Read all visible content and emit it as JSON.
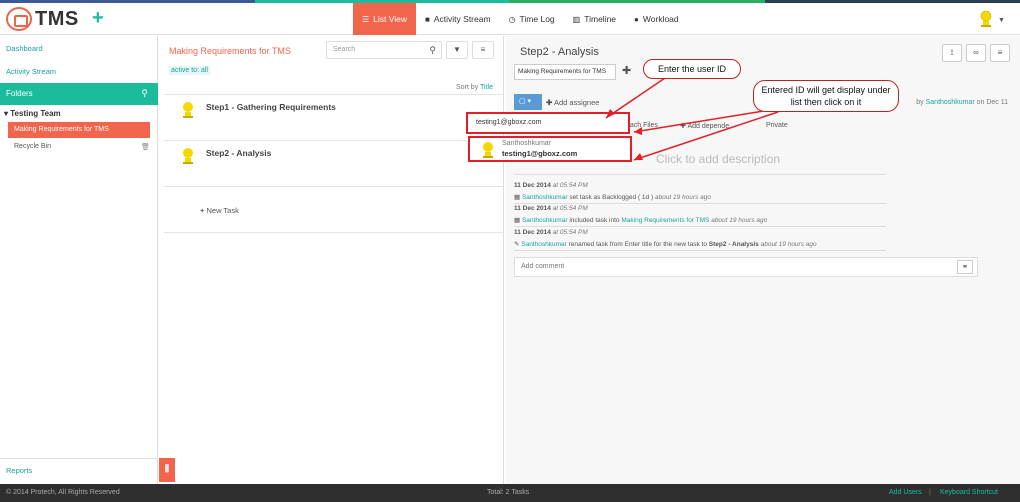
{
  "app": {
    "name": "TMS",
    "add_label": "+"
  },
  "header": {
    "tabs": [
      {
        "label": "List View",
        "icon": "list-icon",
        "active": true
      },
      {
        "label": "Activity Stream",
        "icon": "comment-icon"
      },
      {
        "label": "Time Log",
        "icon": "clock-icon"
      },
      {
        "label": "Timeline",
        "icon": "bars-icon"
      },
      {
        "label": "Workload",
        "icon": "user-icon"
      }
    ]
  },
  "sidebar": {
    "dashboard": "Dashboard",
    "activity_stream": "Activity Stream",
    "folders": "Folders",
    "team": "Testing Team",
    "active_folder": "Making Requirements for TMS",
    "recycle_bin": "Recycle Bin",
    "reports": "Reports"
  },
  "middle": {
    "title": "Making Requirements for TMS",
    "search_placeholder": "Search",
    "filter_tags": "active  to: all",
    "sort_by": "Sort by",
    "sort_field": "Title",
    "tasks": [
      "Step1 - Gathering Requirements",
      "Step2 - Analysis"
    ],
    "new_task": "New Task"
  },
  "detail": {
    "title": "Step2 - Analysis",
    "project": "Making Requirements for TMS",
    "add_assignee": "Add assignee",
    "by": "by",
    "author": "Santhoshkumar",
    "on": "on Dec 11",
    "toolbar": [
      "ttach Files",
      "Add depende",
      "Private"
    ],
    "ghost_text": "Click to add description",
    "activities": [
      {
        "date": "11 Dec 2014",
        "time": "at 05:54 PM",
        "user": "Santhoshkumar",
        "pre": "set task as Backlogged ( 1d )",
        "link": "",
        "post": "",
        "ago": "about 19 hours ago"
      },
      {
        "date": "11 Dec 2014",
        "time": "at 05:54 PM",
        "user": "Santhoshkumar",
        "pre": "included task into",
        "link": "Making Requirements for TMS",
        "post": "",
        "ago": "about 19 hours ago"
      },
      {
        "date": "11 Dec 2014",
        "time": "at 05:54 PM",
        "user": "Santhoshkumar",
        "pre": "renamed task from Enter title for the new task to",
        "link": "",
        "post": "Step2 - Analysis",
        "ago": "about 19 hours ago"
      }
    ],
    "comment_placeholder": "Add comment"
  },
  "overlay": {
    "input_value": "testing1@gboxz.com",
    "suggestion_name": "Santhoshkumar",
    "suggestion_email": "testing1@gboxz.com",
    "callout1": "Enter the user ID",
    "callout2": "Entered ID will get display under list then click on it",
    "annotation_color": "#e31e24"
  },
  "footer": {
    "copyright": "© 2014 Protech, All Rights Reserved",
    "total": "Total: 2 Tasks",
    "add_users": "Add Users",
    "separator": "|",
    "shortcut": "Keyboard Shortcut"
  },
  "colors": {
    "accent": "#f0654b",
    "teal": "#1abc9c",
    "link": "#1aa39a"
  }
}
